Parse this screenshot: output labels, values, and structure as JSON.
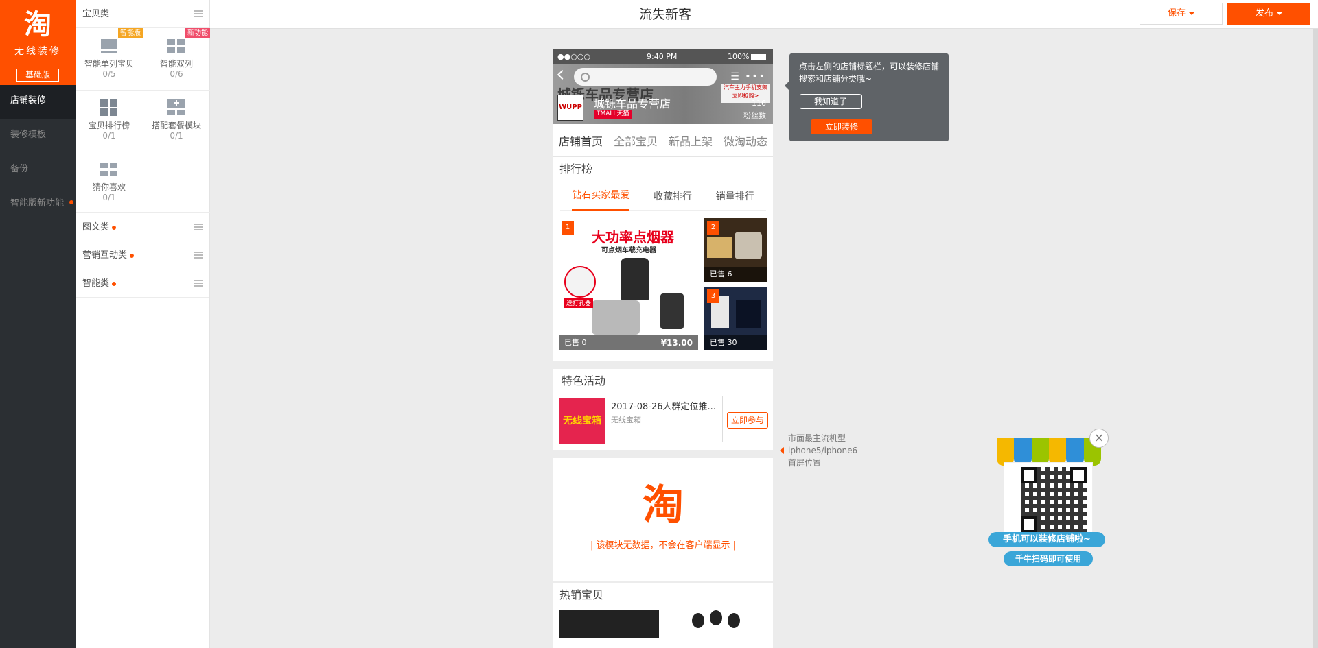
{
  "leftnav": {
    "logo_glyph": "淘",
    "logo_sub": "无线装修",
    "version_badge": "基础版",
    "items": [
      {
        "label": "店铺装修"
      },
      {
        "label": "装修模板"
      },
      {
        "label": "备份"
      },
      {
        "label": "智能版新功能"
      }
    ]
  },
  "modpanel": {
    "category_baby": "宝贝类",
    "modules": [
      {
        "name": "智能单列宝贝",
        "count": "0/5",
        "tag": "智能版"
      },
      {
        "name": "智能双列",
        "count": "0/6",
        "tag": "新功能"
      },
      {
        "name": "宝贝排行榜",
        "count": "0/1"
      },
      {
        "name": "搭配套餐模块",
        "count": "0/1"
      },
      {
        "name": "猜你喜欢",
        "count": "0/1"
      }
    ],
    "categories": [
      {
        "label": "图文类"
      },
      {
        "label": "营销互动类"
      },
      {
        "label": "智能类"
      }
    ]
  },
  "topbar": {
    "title": "流失新客",
    "save_label": "保存",
    "publish_label": "发布"
  },
  "phone": {
    "status": {
      "carrier": "●●○○○",
      "time": "9:40 PM",
      "battery": "100%"
    },
    "shop": {
      "bg_text": "城铄车品专营店",
      "logo_text": "WUPP",
      "name": "城铄车品专营店",
      "tmall": "TMALL天猫",
      "fans_count": "116",
      "fans_label": "粉丝数",
      "promo": "汽车主力手机支架 立即抢购>"
    },
    "tabs": [
      "店铺首页",
      "全部宝贝",
      "新品上架",
      "微淘动态"
    ],
    "ranking": {
      "title": "排行榜",
      "tabs": [
        "钻石买家最爱",
        "收藏排行",
        "销量排行"
      ],
      "products": [
        {
          "rank": "1",
          "headline": "大功率点烟器",
          "subline": "可点烟车载充电器",
          "badge": "送打孔器",
          "sold": "已售 0",
          "price": "¥13.00"
        },
        {
          "rank": "2",
          "sold": "已售 6"
        },
        {
          "rank": "3",
          "sold": "已售 30"
        }
      ]
    },
    "activity": {
      "title": "特色活动",
      "img_text": "无线宝箱",
      "item_title": "2017-08-26人群定位推...",
      "item_sub": "无线宝箱",
      "join": "立即参与"
    },
    "empty_module": {
      "glyph": "淘",
      "message": "|  该模块无数据，不会在客户端显示  |"
    },
    "hot": {
      "title": "热销宝贝"
    }
  },
  "tooltip": {
    "text": "点击左侧的店铺标题栏，可以装修店铺搜索和店铺分类哦~",
    "ok_label": "我知道了",
    "go_label": "立即装修"
  },
  "screen_hint": {
    "line1": "市面最主流机型",
    "line2": "iphone5/iphone6",
    "line3": "首屏位置"
  },
  "qr": {
    "banner1": "手机可以装修店铺啦~",
    "banner2": "千牛扫码即可使用",
    "awning_colors": [
      "#f5b800",
      "#2f8fd8",
      "#9bc400",
      "#f5b800",
      "#2f8fd8",
      "#9bc400"
    ],
    "close": "×"
  },
  "colors": {
    "accent": "#ff5000",
    "nav_bg": "#2b2f33"
  }
}
